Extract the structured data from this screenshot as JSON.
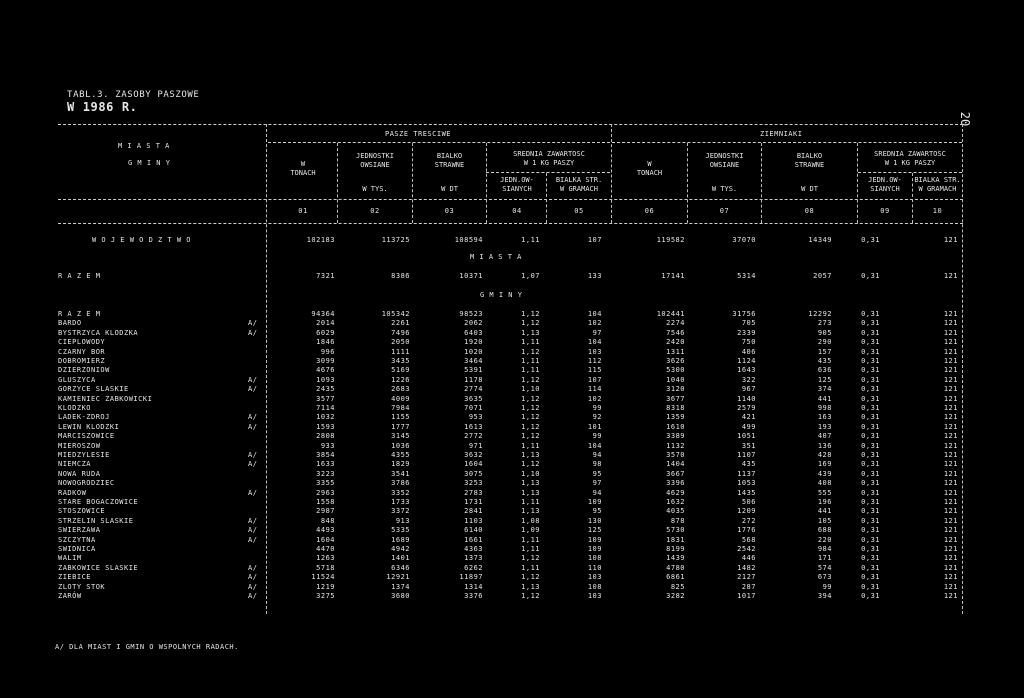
{
  "title": {
    "prefix": "TABL.3. ZASOBY PASZOWE",
    "bold": "W 1986 R."
  },
  "page_number": "20",
  "headers": {
    "stub_top": "M I A S T A",
    "stub_bottom": "G M I N Y",
    "group1": "PASZE TRESCIWE",
    "group2": "ZIEMNIAKI",
    "g1": {
      "c1": "W\nTONACH",
      "c2": "JEDNOSTKI\nOWSIANE",
      "c2b": "W TYS.",
      "c3": "BIALKO\nSTRAWNE",
      "c3b": "W DT",
      "c45": "SREDNIA ZAWARTOSC\nW 1 KG PASZY",
      "c4": "JEDN.OW-\nSIANYCH",
      "c5": "BIALKA STR.\nW GRAMACH"
    },
    "g2": {
      "c6": "W\nTONACH",
      "c7": "JEDNOSTKI\nOWSIANE",
      "c7b": "W TYS.",
      "c8": "BIALKO\nSTRAWNE",
      "c8b": "W DT",
      "c910": "SREDNIA ZAWARTOSC\nW 1 KG PASZY",
      "c9": "JEDN.OW-\nSIANYCH",
      "c10": "BIALKA STR.\nW GRAMACH"
    },
    "colnums": [
      "01",
      "02",
      "03",
      "04",
      "05",
      "06",
      "07",
      "08",
      "09",
      "10"
    ]
  },
  "voivodeship": {
    "label": "W O J E W O D Z T W O",
    "values": [
      "102183",
      "113725",
      "108594",
      "1,11",
      "107",
      "119582",
      "37070",
      "14349",
      "0,31",
      "121"
    ]
  },
  "section_miasta": "M I A S T A",
  "razem_miasta": {
    "label": "R A Z E M",
    "values": [
      "7321",
      "8386",
      "10371",
      "1,07",
      "133",
      "17141",
      "5314",
      "2057",
      "0,31",
      "121"
    ]
  },
  "section_gminy": "G M I N Y",
  "rows": [
    {
      "name": "R A Z E M",
      "mark": "",
      "v": [
        "94364",
        "105342",
        "98523",
        "1,12",
        "104",
        "102441",
        "31756",
        "12292",
        "0,31",
        "121"
      ]
    },
    {
      "name": "BARDO",
      "mark": "A/",
      "v": [
        "2014",
        "2261",
        "2062",
        "1,12",
        "102",
        "2274",
        "705",
        "273",
        "0,31",
        "121"
      ]
    },
    {
      "name": "BYSTRZYCA KLODZKA",
      "mark": "A/",
      "v": [
        "6029",
        "7496",
        "6403",
        "1,13",
        "97",
        "7546",
        "2339",
        "905",
        "0,31",
        "121"
      ]
    },
    {
      "name": "CIEPLOWODY",
      "mark": "",
      "v": [
        "1846",
        "2050",
        "1920",
        "1,11",
        "104",
        "2420",
        "750",
        "290",
        "0,31",
        "121"
      ]
    },
    {
      "name": "CZARNY BOR",
      "mark": "",
      "v": [
        "996",
        "1111",
        "1020",
        "1,12",
        "103",
        "1311",
        "406",
        "157",
        "0,31",
        "121"
      ]
    },
    {
      "name": "DOBROMIERZ",
      "mark": "",
      "v": [
        "3099",
        "3435",
        "3464",
        "1,11",
        "112",
        "3626",
        "1124",
        "435",
        "0,31",
        "121"
      ]
    },
    {
      "name": "DZIERZONIOW",
      "mark": "",
      "v": [
        "4676",
        "5169",
        "5391",
        "1,11",
        "115",
        "5300",
        "1643",
        "636",
        "0,31",
        "121"
      ]
    },
    {
      "name": "GLUSZYCA",
      "mark": "A/",
      "v": [
        "1093",
        "1226",
        "1178",
        "1,12",
        "107",
        "1040",
        "322",
        "125",
        "0,31",
        "121"
      ]
    },
    {
      "name": "GORZYCE SLASKIE",
      "mark": "A/",
      "v": [
        "2435",
        "2683",
        "2774",
        "1,10",
        "114",
        "3120",
        "967",
        "374",
        "0,31",
        "121"
      ]
    },
    {
      "name": "KAMIENIEC ZABKOWICKI",
      "mark": "",
      "v": [
        "3577",
        "4009",
        "3635",
        "1,12",
        "102",
        "3677",
        "1140",
        "441",
        "0,31",
        "121"
      ]
    },
    {
      "name": "KLODZKO",
      "mark": "",
      "v": [
        "7114",
        "7984",
        "7071",
        "1,12",
        "99",
        "8318",
        "2579",
        "998",
        "0,31",
        "121"
      ]
    },
    {
      "name": "LADEK-ZDROJ",
      "mark": "A/",
      "v": [
        "1032",
        "1155",
        "953",
        "1,12",
        "92",
        "1359",
        "421",
        "163",
        "0,31",
        "121"
      ]
    },
    {
      "name": "LEWIN KLODZKI",
      "mark": "A/",
      "v": [
        "1593",
        "1777",
        "1613",
        "1,12",
        "101",
        "1610",
        "499",
        "193",
        "0,31",
        "121"
      ]
    },
    {
      "name": "MARCISZOWICE",
      "mark": "",
      "v": [
        "2808",
        "3145",
        "2772",
        "1,12",
        "99",
        "3389",
        "1051",
        "407",
        "0,31",
        "121"
      ]
    },
    {
      "name": "MIEROSZOW",
      "mark": "",
      "v": [
        "933",
        "1036",
        "971",
        "1,11",
        "104",
        "1132",
        "351",
        "136",
        "0,31",
        "121"
      ]
    },
    {
      "name": "MIEDZYLESIE",
      "mark": "A/",
      "v": [
        "3854",
        "4355",
        "3632",
        "1,13",
        "94",
        "3570",
        "1107",
        "428",
        "0,31",
        "121"
      ]
    },
    {
      "name": "NIEMCZA",
      "mark": "A/",
      "v": [
        "1633",
        "1829",
        "1604",
        "1,12",
        "98",
        "1404",
        "435",
        "169",
        "0,31",
        "121"
      ]
    },
    {
      "name": "NOWA RUDA",
      "mark": "",
      "v": [
        "3223",
        "3541",
        "3075",
        "1,10",
        "95",
        "3667",
        "1137",
        "439",
        "0,31",
        "121"
      ]
    },
    {
      "name": "NOWOGRODZIEC",
      "mark": "",
      "v": [
        "3355",
        "3786",
        "3253",
        "1,13",
        "97",
        "3396",
        "1053",
        "408",
        "0,31",
        "121"
      ]
    },
    {
      "name": "RADKOW",
      "mark": "A/",
      "v": [
        "2963",
        "3352",
        "2783",
        "1,13",
        "94",
        "4629",
        "1435",
        "555",
        "0,31",
        "121"
      ]
    },
    {
      "name": "STARE BOGACZOWICE",
      "mark": "",
      "v": [
        "1558",
        "1733",
        "1731",
        "1,11",
        "109",
        "1632",
        "506",
        "196",
        "0,31",
        "121"
      ]
    },
    {
      "name": "STOSZOWICE",
      "mark": "",
      "v": [
        "2987",
        "3372",
        "2841",
        "1,13",
        "95",
        "4035",
        "1209",
        "441",
        "0,31",
        "121"
      ]
    },
    {
      "name": "STRZELIN SLASKIE",
      "mark": "A/",
      "v": [
        "848",
        "913",
        "1103",
        "1,08",
        "130",
        "878",
        "272",
        "105",
        "0,31",
        "121"
      ]
    },
    {
      "name": "SWIERZAWA",
      "mark": "A/",
      "v": [
        "4493",
        "5335",
        "6140",
        "1,09",
        "125",
        "5730",
        "1776",
        "688",
        "0,31",
        "121"
      ]
    },
    {
      "name": "SZCZYTNA",
      "mark": "A/",
      "v": [
        "1604",
        "1689",
        "1661",
        "1,11",
        "109",
        "1831",
        "568",
        "220",
        "0,31",
        "121"
      ]
    },
    {
      "name": "SWIDNICA",
      "mark": "",
      "v": [
        "4470",
        "4942",
        "4363",
        "1,11",
        "109",
        "8199",
        "2542",
        "984",
        "0,31",
        "121"
      ]
    },
    {
      "name": "WALIM",
      "mark": "",
      "v": [
        "1263",
        "1401",
        "1373",
        "1,12",
        "108",
        "1439",
        "446",
        "171",
        "0,31",
        "121"
      ]
    },
    {
      "name": "ZABKOWICE SLASKIE",
      "mark": "A/",
      "v": [
        "5718",
        "6346",
        "6262",
        "1,11",
        "110",
        "4780",
        "1482",
        "574",
        "0,31",
        "121"
      ]
    },
    {
      "name": "ZIEBICE",
      "mark": "A/",
      "v": [
        "11524",
        "12921",
        "11897",
        "1,12",
        "103",
        "6861",
        "2127",
        "673",
        "0,31",
        "121"
      ]
    },
    {
      "name": "ZLOTY STOK",
      "mark": "A/",
      "v": [
        "1219",
        "1374",
        "1314",
        "1,13",
        "108",
        "825",
        "287",
        "99",
        "0,31",
        "121"
      ]
    },
    {
      "name": "ZARÓW",
      "mark": "A/",
      "v": [
        "3275",
        "3680",
        "3376",
        "1,12",
        "103",
        "3282",
        "1017",
        "394",
        "0,31",
        "121"
      ]
    }
  ],
  "footnote": "A/ DLA MIAST I GMIN O WSPOLNYCH RADACH."
}
